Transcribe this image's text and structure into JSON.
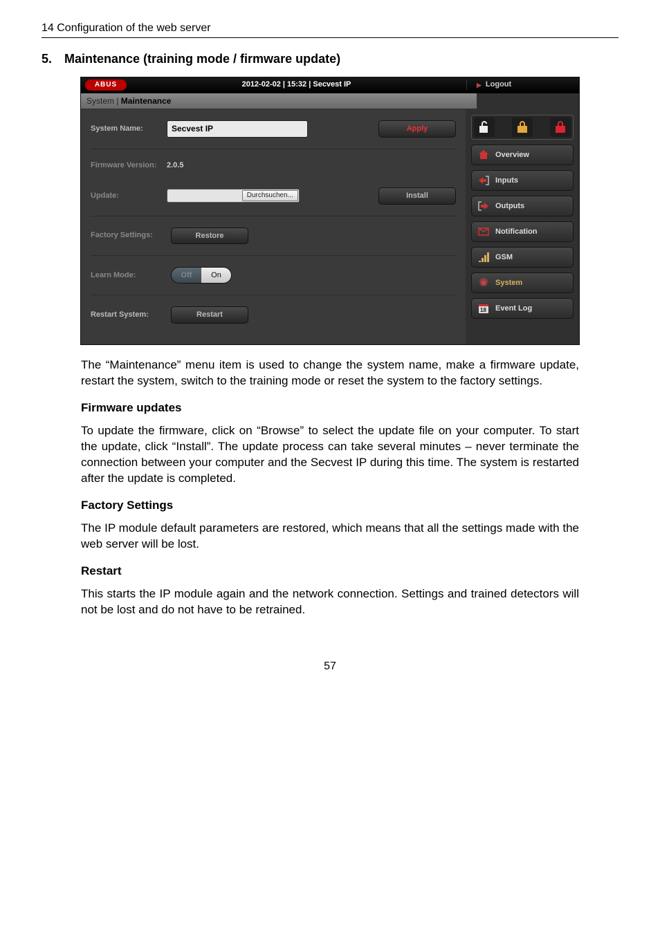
{
  "page_header": "14  Configuration of the web server",
  "section": {
    "number": "5.",
    "title": "Maintenance (training mode / firmware update)"
  },
  "app": {
    "logo": "ABUS",
    "top_text": "2012-02-02  |  15:32  |  Secvest IP",
    "logout": "Logout",
    "breadcrumb_prefix": "System | ",
    "breadcrumb_current": "Maintenance",
    "system_name_label": "System Name:",
    "system_name_value": "Secvest IP",
    "apply_btn": "Apply",
    "fw_version_label": "Firmware Version:",
    "fw_version_value": "2.0.5",
    "update_label": "Update:",
    "browse_btn": "Durchsuchen...",
    "install_btn": "Install",
    "factory_label": "Factory Settings:",
    "restore_btn": "Restore",
    "learn_label": "Learn Mode:",
    "toggle_off": "Off",
    "toggle_on": "On",
    "restart_label": "Restart System:",
    "restart_btn": "Restart",
    "nav": {
      "overview": "Overview",
      "inputs": "Inputs",
      "outputs": "Outputs",
      "notification": "Notification",
      "gsm": "GSM",
      "system": "System",
      "eventlog": "Event Log",
      "cal_badge": "18"
    }
  },
  "body": {
    "p1": "The “Maintenance” menu item is used to change the system name, make a firmware update, restart the system, switch to the training mode or reset the system to the factory settings.",
    "h2": "Firmware updates",
    "p2": "To update the firmware, click on “Browse” to select the update file on your computer. To start the update, click “Install”. The update process can take several minutes – never terminate the connection between your computer and the Secvest IP during this time. The system is restarted after the update is completed.",
    "h3": "Factory Settings",
    "p3": "The IP module default parameters are restored, which means that all the settings made with the web server will be lost.",
    "h4": "Restart",
    "p4": "This starts the IP module again and the network connection. Settings and trained detectors will not be lost and do not have to be retrained."
  },
  "page_number": "57"
}
